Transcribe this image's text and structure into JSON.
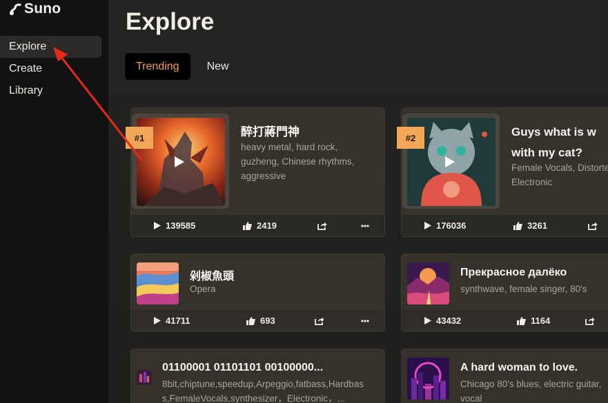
{
  "app": {
    "brand": "Suno"
  },
  "sidebar": {
    "items": [
      {
        "label": "Explore",
        "active": true
      },
      {
        "label": "Create",
        "active": false
      },
      {
        "label": "Library",
        "active": false
      }
    ]
  },
  "main": {
    "title": "Explore",
    "tabs": [
      {
        "label": "Trending",
        "active": true
      },
      {
        "label": "New",
        "active": false
      }
    ]
  },
  "colors": {
    "accent": "#f4a23b",
    "rank_badge": "#f2a657",
    "annotation_arrow": "#e8291c"
  },
  "songs": [
    {
      "rank": "#1",
      "title": "醉打蔣門神",
      "tags_line1": "heavy metal, hard rock,",
      "tags_line2": "guzheng, Chinese rhythms,",
      "tags_line3": "aggressive",
      "plays": "139585",
      "likes": "2419"
    },
    {
      "rank": "#2",
      "title_line1": "Guys what is w",
      "title_line2": "with my cat?",
      "tags_line1": "Female Vocals, Distorte",
      "tags_line2": "Electronic",
      "plays": "176036",
      "likes": "3261"
    },
    {
      "title": "剁椒魚頭",
      "tags": "Opera",
      "plays": "41711",
      "likes": "693"
    },
    {
      "title": "Прекрасное далёко",
      "tags": "synthwave, female singer, 80's",
      "plays": "43432",
      "likes": "1164"
    },
    {
      "title": "01100001 01101101 00100000...",
      "tags_line1": "8bit,chiptune,speedup,Arpeggio,fatbass,Hardbas",
      "tags_line2": "s,FemaleVocals,synthesizer，Electronic，..."
    },
    {
      "title": "A hard woman to love.",
      "tags_line1": "Chicago 80's blues, electric guitar,",
      "tags_line2": "vocal"
    }
  ]
}
